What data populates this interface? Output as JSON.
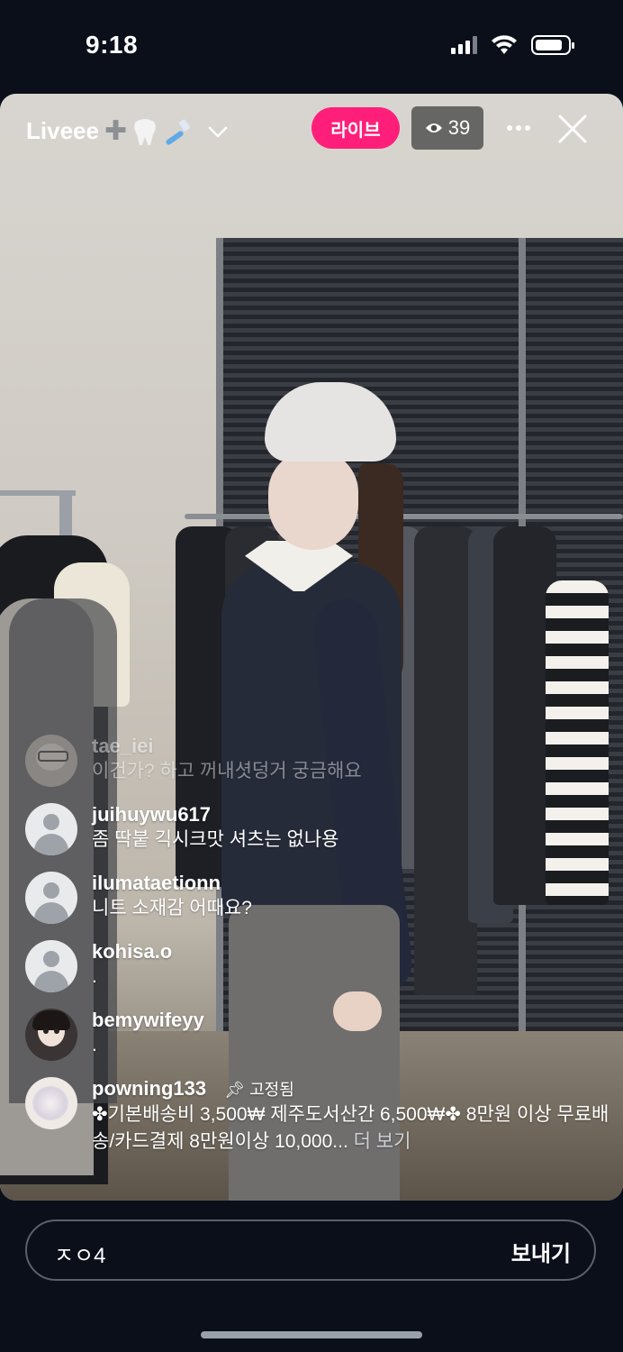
{
  "status_bar": {
    "time": "9:18",
    "signal_bars": 3,
    "signal_bars_total": 4,
    "battery_level": 0.85,
    "icons": [
      "cellular-signal-icon",
      "wifi-icon",
      "battery-icon"
    ]
  },
  "header": {
    "channel_name": "Liveee",
    "channel_emojis": [
      "plus-icon",
      "tooth-icon",
      "toothbrush-icon"
    ],
    "live_label": "라이브",
    "viewer_count": "39",
    "accent_color": "#ff1f7a"
  },
  "comments": [
    {
      "user": "tae_iei",
      "text": "이건가? 하고 꺼내셧덩거 궁금해요",
      "faded": true
    },
    {
      "user": "juihuywu617",
      "text": "좀 딱붙 긱시크맛 셔츠는 없나용"
    },
    {
      "user": "ilumataetionn",
      "text": "니트 소재감 어때요?"
    },
    {
      "user": "kohisa.o",
      "text": "."
    },
    {
      "user": "bemywifeyy",
      "text": "."
    },
    {
      "user": "powning133",
      "pinned_label": "고정됨",
      "text": "✤기본배송비 3,500₩ 제주도서산간 6,500₩✤  8만원 이상 무료배송/카드결제 8만원이상 10,000...",
      "more_label": "더 보기"
    }
  ],
  "composer": {
    "input_value": "ㅈㅇ4",
    "send_label": "보내기"
  }
}
